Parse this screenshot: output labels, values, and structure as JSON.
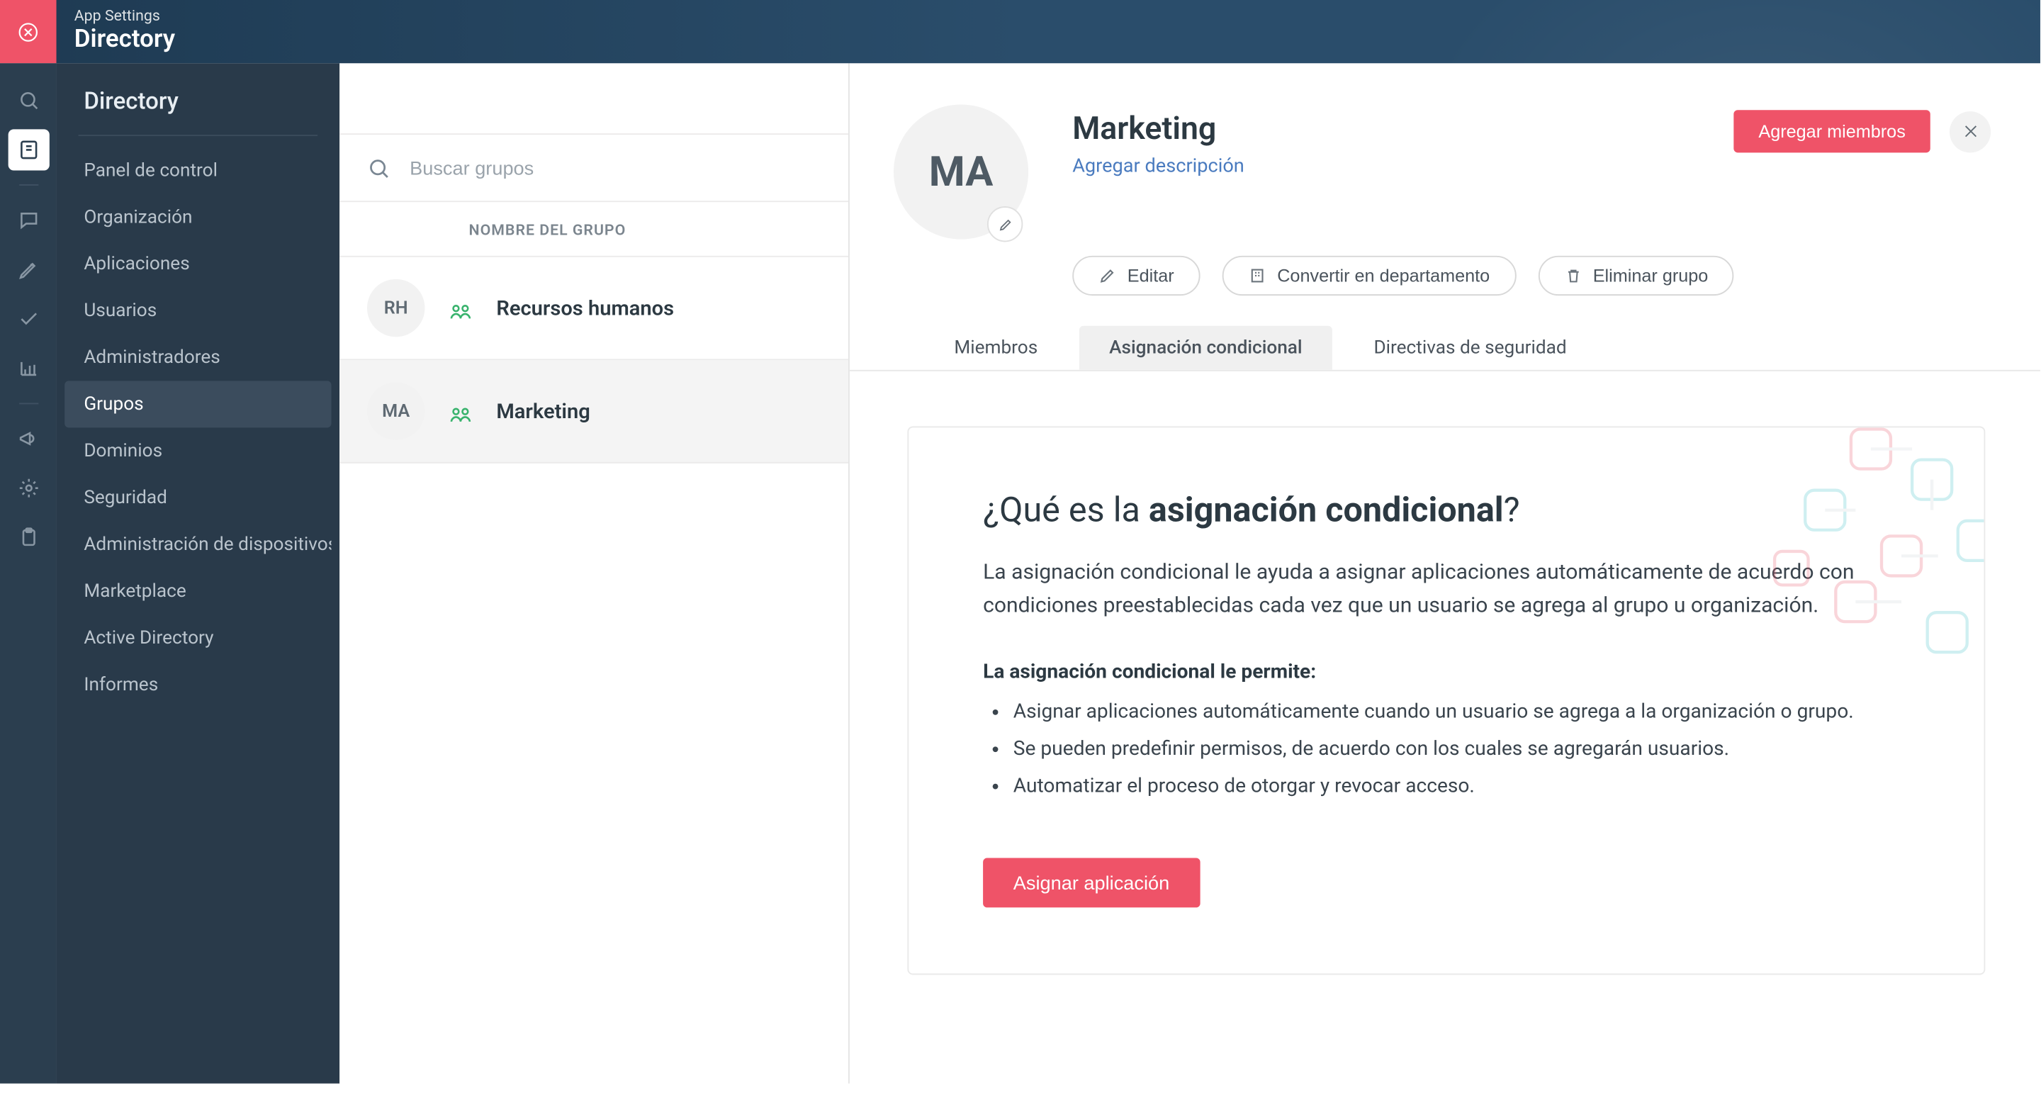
{
  "header": {
    "app_settings": "App Settings",
    "title": "Directory"
  },
  "rail": {
    "items": [
      "search",
      "directory",
      "sep",
      "chat",
      "reports",
      "tasks",
      "analytics",
      "sep",
      "announce",
      "extensions",
      "clipboard"
    ]
  },
  "sidebar": {
    "title": "Directory",
    "items": [
      {
        "label": "Panel de control",
        "key": "dashboard"
      },
      {
        "label": "Organización",
        "key": "organization"
      },
      {
        "label": "Aplicaciones",
        "key": "applications"
      },
      {
        "label": "Usuarios",
        "key": "users"
      },
      {
        "label": "Administradores",
        "key": "admins"
      },
      {
        "label": "Grupos",
        "key": "groups",
        "active": true
      },
      {
        "label": "Dominios",
        "key": "domains"
      },
      {
        "label": "Seguridad",
        "key": "security"
      },
      {
        "label": "Administración de dispositivos",
        "key": "device-mgmt"
      },
      {
        "label": "Marketplace",
        "key": "marketplace"
      },
      {
        "label": "Active Directory",
        "key": "active-directory"
      },
      {
        "label": "Informes",
        "key": "reports"
      }
    ]
  },
  "groups_col": {
    "search_placeholder": "Buscar grupos",
    "column_header": "NOMBRE DEL GRUPO",
    "rows": [
      {
        "initials": "RH",
        "name": "Recursos humanos",
        "selected": false
      },
      {
        "initials": "MA",
        "name": "Marketing",
        "selected": true
      }
    ]
  },
  "detail": {
    "avatar_initials": "MA",
    "title": "Marketing",
    "add_description": "Agregar descripción",
    "add_members": "Agregar miembros",
    "actions": {
      "edit": "Editar",
      "convert": "Convertir en departamento",
      "delete": "Eliminar grupo"
    },
    "tabs": [
      {
        "label": "Miembros",
        "key": "members"
      },
      {
        "label": "Asignación condicional",
        "key": "conditional",
        "active": true
      },
      {
        "label": "Directivas de seguridad",
        "key": "security-policies"
      }
    ],
    "card": {
      "heading_prefix": "¿Qué es la ",
      "heading_bold": "asignación condicional",
      "heading_suffix": "?",
      "description": "La asignación condicional le ayuda a asignar aplicaciones automáticamente de acuerdo con condiciones preestablecidas cada vez que un usuario se agrega al grupo u organización.",
      "subheading": "La asignación condicional le permite:",
      "bullets": [
        "Asignar aplicaciones automáticamente cuando un usuario se agrega a la organización o grupo.",
        "Se pueden predefinir permisos, de acuerdo con los cuales se agregarán usuarios.",
        "Automatizar el proceso de otorgar y revocar acceso."
      ],
      "cta": "Asignar aplicación"
    }
  },
  "colors": {
    "accent": "#ef5368",
    "link": "#4a7bbf"
  }
}
